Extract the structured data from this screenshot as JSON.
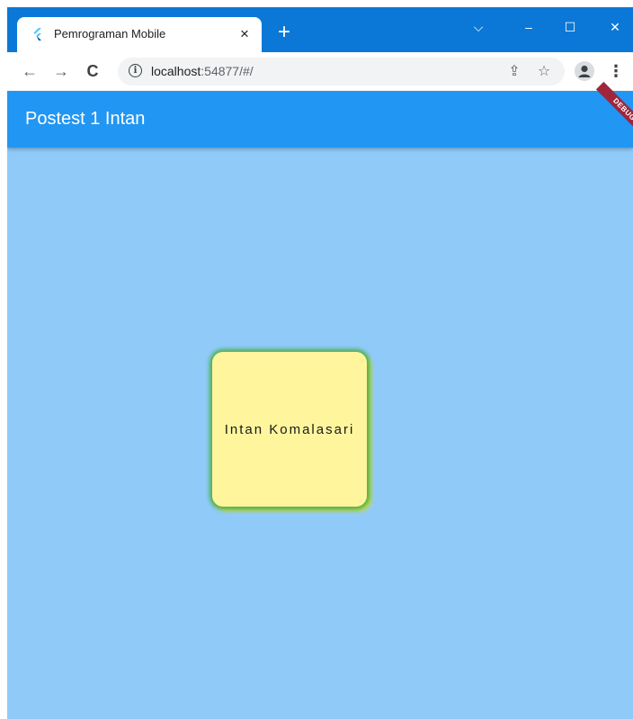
{
  "browser": {
    "tab": {
      "title": "Pemrograman Mobile",
      "close_symbol": "×"
    },
    "new_tab_symbol": "+",
    "window_controls": {
      "tabsearch_symbol": "⌵",
      "minimize_symbol": "–",
      "maximize_symbol": "☐",
      "close_symbol": "✕"
    },
    "toolbar": {
      "back_symbol": "←",
      "forward_symbol": "→",
      "reload_symbol": "C",
      "info_symbol": "i",
      "url_host": "localhost",
      "url_rest": ":54877/#/",
      "share_symbol": "⇪",
      "bookmark_symbol": "☆",
      "menu_symbol": "⋮"
    }
  },
  "app": {
    "appbar_title": "Postest 1 Intan",
    "debug_label": "DEBUG",
    "card_text": "Intan Komalasari"
  },
  "colors": {
    "tabstrip": "#0b78d7",
    "appbar": "#2196f3",
    "body": "#90caf9",
    "card": "#fff59d",
    "card_glow": "#4caf50",
    "card_shadow": "#cddc39",
    "debug_ribbon": "#a0253c"
  },
  "icons": {
    "favicon": "flutter-icon",
    "profile": "person-icon"
  }
}
